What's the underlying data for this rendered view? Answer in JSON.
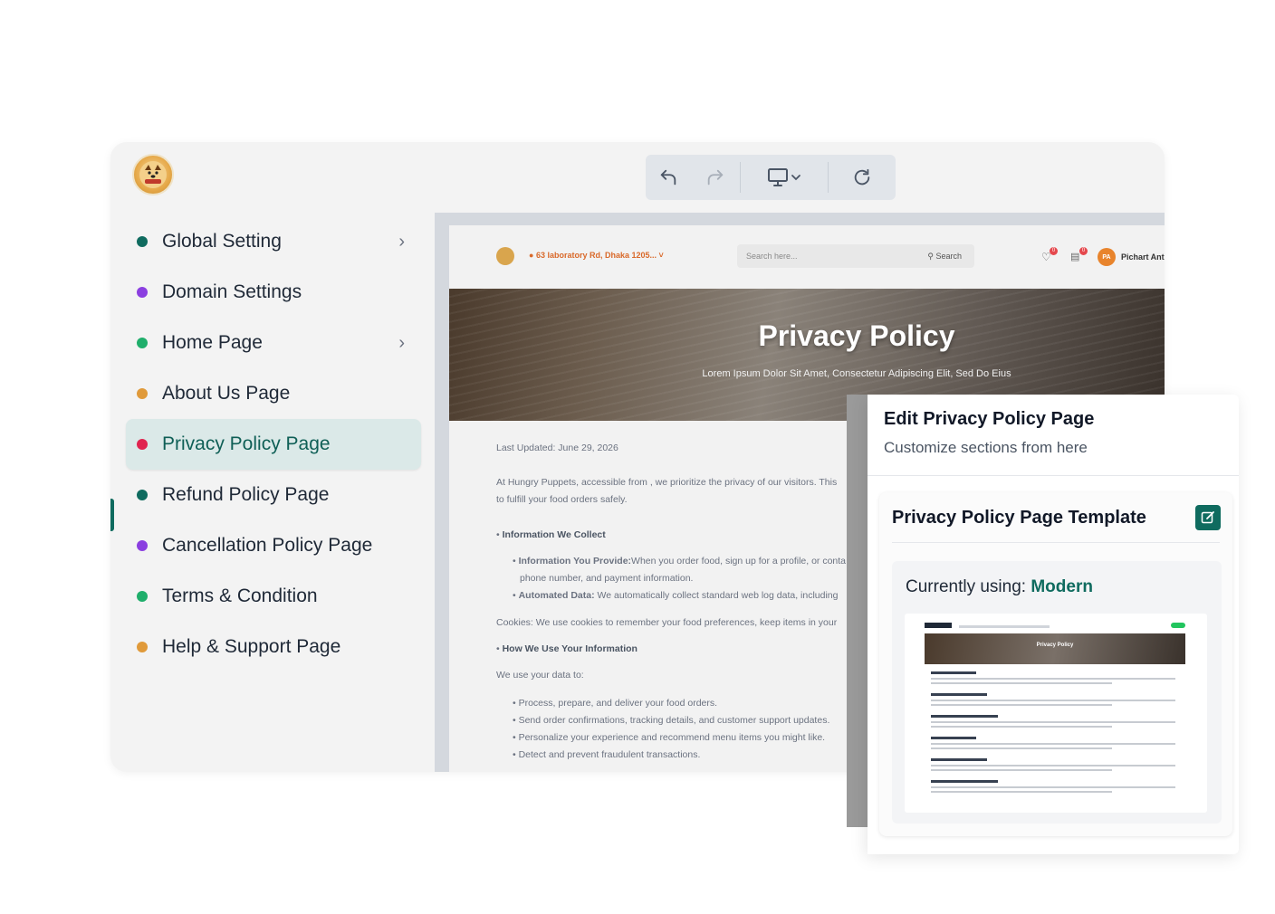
{
  "toolbar": {
    "undo": "undo-icon",
    "redo": "redo-icon",
    "device": "monitor-icon",
    "refresh": "refresh-icon"
  },
  "brand": {
    "logo_text": "hungry puppets"
  },
  "sidebar": {
    "items": [
      {
        "label": "Global Setting",
        "color": "#0f6b5f",
        "has_chevron": true
      },
      {
        "label": "Domain Settings",
        "color": "#8b3fe0"
      },
      {
        "label": "Home Page",
        "color": "#1fae6b",
        "has_chevron": true
      },
      {
        "label": "About Us Page",
        "color": "#e09a3a"
      },
      {
        "label": "Privacy Policy Page",
        "color": "#e0244f",
        "active": true
      },
      {
        "label": "Refund Policy Page",
        "color": "#0f6b5f"
      },
      {
        "label": "Cancellation Policy Page",
        "color": "#8b3fe0"
      },
      {
        "label": "Terms & Condition",
        "color": "#1fae6b"
      },
      {
        "label": "Help & Support Page",
        "color": "#e09a3a"
      }
    ]
  },
  "preview": {
    "location": "63 laboratory Rd, Dhaka 1205...",
    "search_placeholder": "Search here...",
    "search_button": "Search",
    "wishlist_count": "0",
    "cart_count": "0",
    "avatar_initials": "PA",
    "user_name": "Pichart Ant",
    "hero_title": "Privacy Policy",
    "hero_subtitle": "Lorem Ipsum Dolor Sit Amet, Consectetur Adipiscing Elit, Sed Do Eius",
    "last_updated": "Last Updated: June 29, 2026",
    "intro_1": "At Hungry Puppets, accessible from , we prioritize the privacy of our visitors. This",
    "intro_2": "to fulfill your food orders safely.",
    "sec1_title": "Information We Collect",
    "sec1_b1_label": "Information You Provide:",
    "sec1_b1_text": "When you order food, sign up for a profile, or conta",
    "sec1_b1_cont": "phone number, and payment information.",
    "sec1_b2_label": "Automated Data:",
    "sec1_b2_text": " We automatically collect standard web log data, including",
    "cookies": "Cookies: We use cookies to remember your food preferences, keep items in your",
    "sec2_title": "How We Use Your Information",
    "sec2_intro": "We use your data to:",
    "sec2_items": [
      "Process, prepare, and deliver your food orders.",
      "Send order confirmations, tracking details, and customer support updates.",
      "Personalize your experience and recommend menu items you might like.",
      "Detect and prevent fraudulent transactions."
    ]
  },
  "panel": {
    "title": "Edit Privacy Policy Page",
    "subtitle": "Customize sections from here",
    "template_title": "Privacy Policy Page Template",
    "using_label": "Currently using: ",
    "using_value": "Modern",
    "thumb_hero": "Privacy Policy"
  },
  "colors": {
    "accent": "#0f6b5f",
    "active_bg": "#dbe9e8"
  }
}
